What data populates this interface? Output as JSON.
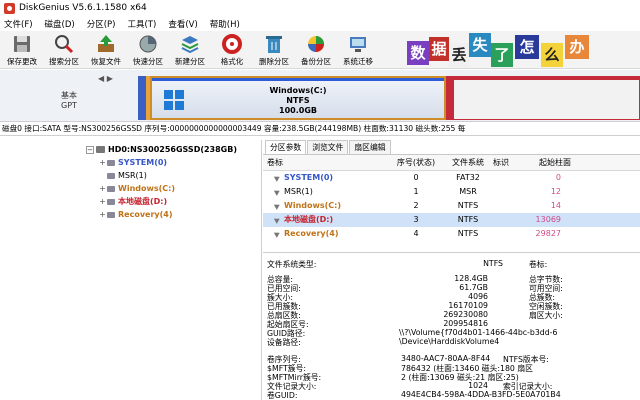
{
  "window": {
    "title": "DiskGenius V5.6.1.1580 x64"
  },
  "menu": [
    "文件(F)",
    "磁盘(D)",
    "分区(P)",
    "工具(T)",
    "查看(V)",
    "帮助(H)"
  ],
  "toolbar": [
    {
      "label": "保存更改",
      "icon": "save-icon"
    },
    {
      "label": "搜索分区",
      "icon": "search-partition-icon"
    },
    {
      "label": "恢复文件",
      "icon": "recover-file-icon"
    },
    {
      "label": "快速分区",
      "icon": "quick-partition-icon"
    },
    {
      "label": "新建分区",
      "icon": "new-partition-icon"
    },
    {
      "label": "格式化",
      "icon": "format-icon"
    },
    {
      "label": "删除分区",
      "icon": "delete-partition-icon"
    },
    {
      "label": "备份分区",
      "icon": "backup-partition-icon"
    },
    {
      "label": "系统迁移",
      "icon": "system-migrate-icon"
    }
  ],
  "banner": {
    "chars": [
      "数",
      "据",
      "丢",
      "失",
      "了",
      "怎",
      "么",
      "办"
    ]
  },
  "disk_map": {
    "nav_arrows": "◀ ▶",
    "label_line1": "基本",
    "label_line2": "GPT",
    "partition_name": "Windows(C:)",
    "partition_fs": "NTFS",
    "partition_size": "100.0GB"
  },
  "disk_info": "磁盘0 接口:SATA  型号:NS300256GSSD  序列号:0000000000000003449  容量:238.5GB(244198MB)  柱面数:31130  磁头数:255  每",
  "tree": {
    "disk": "HD0:NS300256GSSD(238GB)",
    "items": [
      {
        "name": "SYSTEM(0)",
        "color": "#3556c8"
      },
      {
        "name": "MSR(1)",
        "color": "#000000"
      },
      {
        "name": "Windows(C:)",
        "color": "#c07218"
      },
      {
        "name": "本地磁盘(D:)",
        "color": "#c5222f"
      },
      {
        "name": "Recovery(4)",
        "color": "#c07218"
      }
    ]
  },
  "tabs": [
    "分区参数",
    "浏览文件",
    "扇区编辑"
  ],
  "partition_table": {
    "headers": [
      "卷标",
      "序号(状态)",
      "文件系统",
      "标识",
      "起始柱面"
    ],
    "rows": [
      {
        "name": "SYSTEM(0)",
        "seq": "0",
        "fs": "FAT32",
        "id": "",
        "start": "0"
      },
      {
        "name": "MSR(1)",
        "seq": "1",
        "fs": "MSR",
        "id": "",
        "start": "12"
      },
      {
        "name": "Windows(C:)",
        "seq": "2",
        "fs": "NTFS",
        "id": "",
        "start": "14"
      },
      {
        "name": "本地磁盘(D:)",
        "seq": "3",
        "fs": "NTFS",
        "id": "",
        "start": "13069"
      },
      {
        "name": "Recovery(4)",
        "seq": "4",
        "fs": "NTFS",
        "id": "",
        "start": "29827"
      }
    ]
  },
  "details": {
    "fs_type_label": "文件系统类型:",
    "fs_type_value": "NTFS",
    "volume_label": "卷标:",
    "rows_left": [
      {
        "label": "总容量:",
        "value": "128.4GB"
      },
      {
        "label": "已用空间:",
        "value": "61.7GB"
      },
      {
        "label": "簇大小:",
        "value": "4096"
      },
      {
        "label": "已用簇数:",
        "value": "16170109"
      },
      {
        "label": "总扇区数:",
        "value": "269230080"
      },
      {
        "label": "起始扇区号:",
        "value": "209954816"
      },
      {
        "label": "GUID路径:",
        "value": "\\\\?\\Volume{f70d4b01-1466-44bc-b3dd-6"
      },
      {
        "label": "设备路径:",
        "value": "\\Device\\HarddiskVolume4"
      }
    ],
    "rows_right": [
      "总字节数:",
      "可用空间:",
      "总簇数:",
      "空闲簇数:",
      "扇区大小:"
    ],
    "bottom": [
      {
        "label": "卷序列号:",
        "value": "3480-AAC7-80AA-8F44",
        "right": "NTFS版本号:"
      },
      {
        "label": "$MFT簇号:",
        "value": "786432 (柱面:13460 磁头:180 扇区",
        "right": ""
      },
      {
        "label": "$MFTMirr簇号:",
        "value": "2 (柱面:13069 磁头:21 扇区:25)",
        "right": ""
      },
      {
        "label": "文件记录大小:",
        "value": "1024",
        "right": "索引记录大小:"
      },
      {
        "label": "卷GUID:",
        "value": "494E4CB4-598A-4DDA-B3FD-5E0A701B4",
        "right": ""
      }
    ]
  },
  "colors": {
    "accent_blue": "#3556c8",
    "system_orange": "#c07218",
    "data_red": "#c5222f",
    "selection": "#cfe2f7"
  }
}
